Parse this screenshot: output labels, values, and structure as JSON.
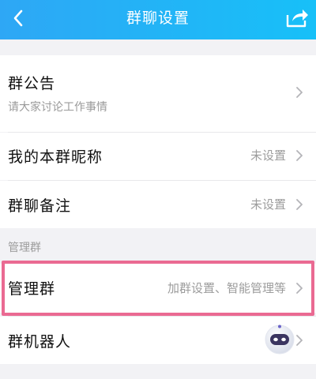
{
  "header": {
    "title": "群聊设置",
    "back_icon": "chevron-left-icon",
    "share_icon": "share-icon",
    "color_start": "#2ea7f5",
    "color_end": "#17c0f8"
  },
  "announcement": {
    "label": "群公告",
    "content": "请大家讨论工作事情"
  },
  "nickname": {
    "label": "我的本群昵称",
    "value": "未设置"
  },
  "remark": {
    "label": "群聊备注",
    "value": "未设置"
  },
  "manage_section": {
    "header": "管理群"
  },
  "manage": {
    "label": "管理群",
    "value": "加群设置、智能管理等"
  },
  "robot": {
    "label": "群机器人",
    "icon": "robot-avatar-icon"
  },
  "colors": {
    "highlight": "#ea6a92",
    "background": "#f2f2f5"
  }
}
